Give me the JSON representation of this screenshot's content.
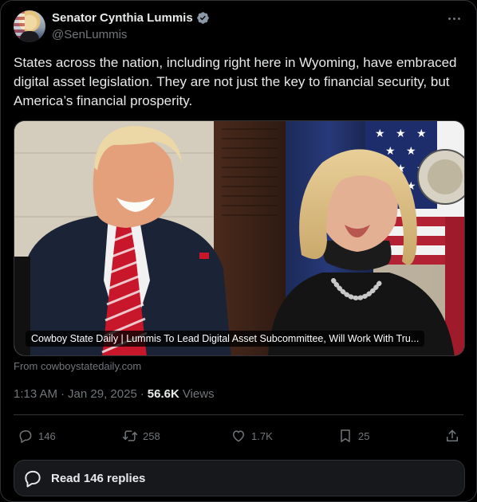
{
  "author": {
    "display_name": "Senator Cynthia Lummis",
    "handle": "@SenLummis",
    "verified_icon": "verified-badge-icon",
    "badge_color": "#8b98a5"
  },
  "tweet": {
    "text": "States across the nation, including right here in Wyoming, have embraced digital asset legislation. They are not just the key to financial security, but America’s financial prosperity."
  },
  "media": {
    "caption": "Cowboy State Daily | Lummis To Lead Digital Asset Subcommittee, Will Work With Tru...",
    "source": "From cowboystatedaily.com"
  },
  "meta": {
    "time": "1:13 AM",
    "sep1": "·",
    "date": "Jan 29, 2025",
    "sep2": "·",
    "views_count": "56.6K",
    "views_label": "Views"
  },
  "actions": {
    "replies": "146",
    "reposts": "258",
    "likes": "1.7K",
    "bookmarks": "25"
  },
  "read_replies": {
    "label": "Read 146 replies"
  },
  "colors": {
    "background": "#000000",
    "text": "#e7e9ea",
    "muted": "#71767b",
    "border": "#2f3336"
  }
}
